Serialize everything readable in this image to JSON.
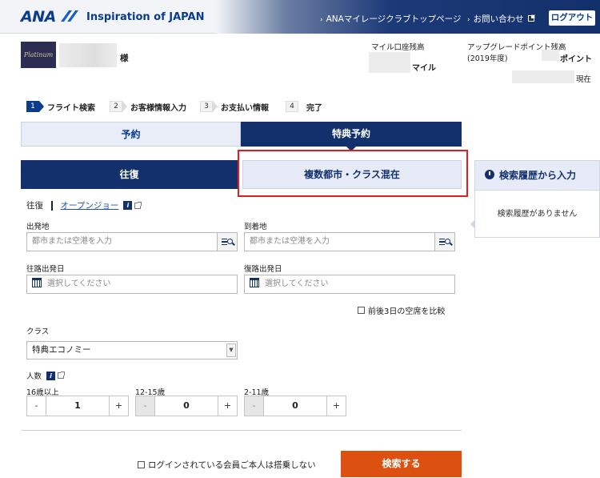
{
  "header": {
    "logo": "ANA",
    "tagline": "Inspiration of JAPAN",
    "nav_links": [
      "ANAマイレージクラブトップページ",
      "お問い合わせ"
    ],
    "logout": "ログアウト"
  },
  "member": {
    "badge": "Platinum",
    "honorific": "様",
    "miles_label": "マイル口座残高",
    "miles_unit": "マイル",
    "upgrade_label": "アップグレードポイント残高",
    "upgrade_year": "(2019年度)",
    "upgrade_unit": "ポイント",
    "as_of": "現在"
  },
  "steps": [
    {
      "num": "1",
      "label": "フライト検索",
      "active": true
    },
    {
      "num": "2",
      "label": "お客様情報入力",
      "active": false
    },
    {
      "num": "3",
      "label": "お支払い情報",
      "active": false
    },
    {
      "num": "4",
      "label": "完了",
      "active": false
    }
  ],
  "tabs": {
    "reservation": "予約",
    "award": "特典予約"
  },
  "subtabs": {
    "round_trip": "往復",
    "multi_city": "複数都市・クラス混在"
  },
  "history": {
    "title": "検索履歴から入力",
    "empty": "検索履歴がありません"
  },
  "trip": {
    "round_trip": "往復",
    "open_jaw": "オープンジョー"
  },
  "form": {
    "origin_label": "出発地",
    "origin_placeholder": "都市または空港を入力",
    "dest_label": "到着地",
    "dest_placeholder": "都市または空港を入力",
    "depart_label": "往路出発日",
    "depart_placeholder": "選択してください",
    "return_label": "復路出発日",
    "return_placeholder": "選択してください",
    "compare_label": "前後3日の空席を比較",
    "class_label": "クラス",
    "class_value": "特典エコノミー",
    "pax_label": "人数",
    "pax": [
      {
        "label": "16歳以上",
        "value": "1"
      },
      {
        "label": "12-15歳",
        "value": "0"
      },
      {
        "label": "2-11歳",
        "value": "0"
      }
    ],
    "minus": "-",
    "plus": "+",
    "not_boarding": "ログインされている会員ご本人は搭乗しない",
    "submit": "検索する"
  }
}
